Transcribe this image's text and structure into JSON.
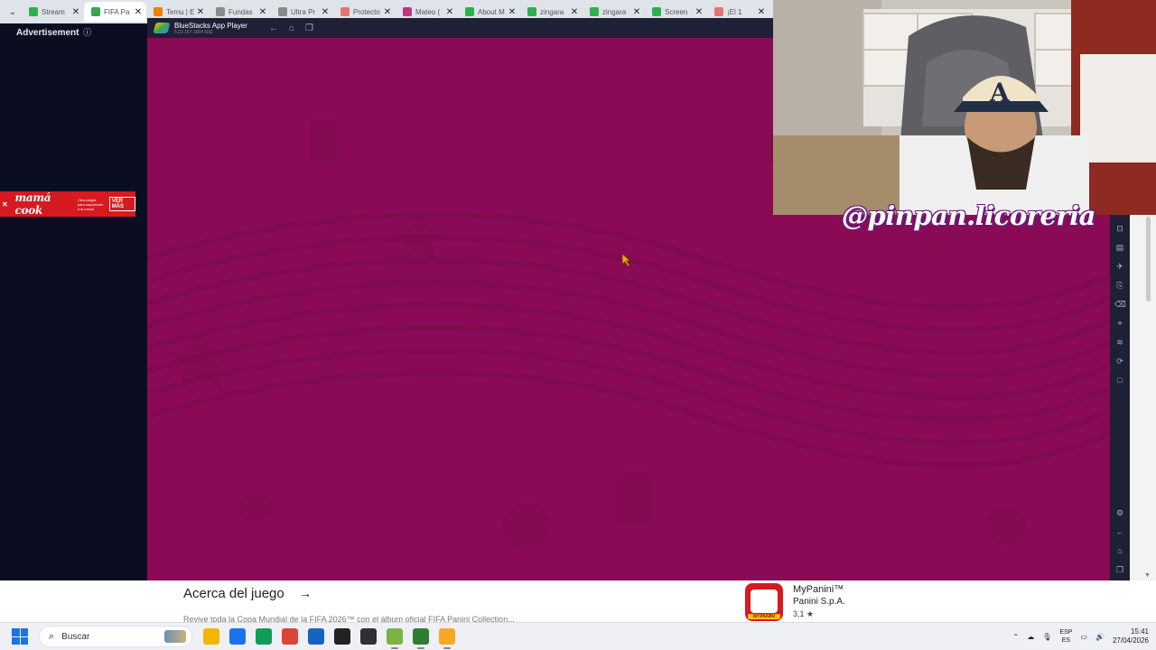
{
  "browser": {
    "tabs": [
      {
        "title": "Stream",
        "favicon_color": "#2bb24c",
        "active": false
      },
      {
        "title": "FIFA Pa",
        "favicon_color": "#34a853",
        "active": true
      },
      {
        "title": "Temu | E",
        "favicon_color": "#f57c00",
        "active": false
      },
      {
        "title": "Fundas",
        "favicon_color": "#8a8a8a",
        "active": false
      },
      {
        "title": "Ultra Pr",
        "favicon_color": "#8a8a8a",
        "active": false
      },
      {
        "title": "Protecto",
        "favicon_color": "#e57373",
        "active": false
      },
      {
        "title": "Mateo (",
        "favicon_color": "#c13584",
        "active": false
      },
      {
        "title": "About M",
        "favicon_color": "#2bb24c",
        "active": false
      },
      {
        "title": "zingara",
        "favicon_color": "#2bb24c",
        "active": false
      },
      {
        "title": "zingara",
        "favicon_color": "#2bb24c",
        "active": false
      },
      {
        "title": "Screen",
        "favicon_color": "#2bb24c",
        "active": false
      },
      {
        "title": "¡El 1",
        "favicon_color": "#e57373",
        "active": false
      }
    ]
  },
  "ad": {
    "label": "Advertisement",
    "info_icon": "info-icon",
    "banner": {
      "brand": "mamá cook",
      "tagline": "¡Tecnología para sorprender a la mesa!",
      "cta": "VER MÁS"
    }
  },
  "bluestacks": {
    "title": "BlueStacks App Player",
    "version": "5.22.167.1004 N32",
    "nav_icons": [
      "back-icon",
      "home-icon",
      "recents-icon"
    ],
    "toolbar_icons": [
      "screenshot-icon",
      "media-icon",
      "airplane-icon",
      "apk-icon",
      "eraser-icon",
      "location-icon",
      "layers-icon",
      "sync-icon",
      "blank-icon"
    ],
    "bottom_icons": [
      "settings-icon",
      "back-icon",
      "home-icon",
      "recents-icon"
    ]
  },
  "stream": {
    "watermark": "@pinpan.licoreria"
  },
  "store": {
    "section_title": "Acerca del juego",
    "description": "Revive toda la Copa Mundial de la FIFA 2026™ con el álbum oficial FIFA Panini Collection...",
    "app": {
      "name": "MyPanini™",
      "developer": "Panini S.p.A.",
      "rating": "3,1 ★",
      "icon_label": "MYPANINI"
    }
  },
  "taskbar": {
    "search_placeholder": "Buscar",
    "apps": [
      {
        "name": "file-explorer-icon",
        "color": "#f4b400"
      },
      {
        "name": "store-icon",
        "color": "#1a73e8"
      },
      {
        "name": "edge-icon",
        "color": "#0f9d58"
      },
      {
        "name": "chrome-icon",
        "color": "#db4437"
      },
      {
        "name": "notepad-icon",
        "color": "#1565c0"
      },
      {
        "name": "obs-icon",
        "color": "#222222"
      },
      {
        "name": "media-player-icon",
        "color": "#303030"
      },
      {
        "name": "bluestacks-icon",
        "color": "#7cb342"
      },
      {
        "name": "capcut-icon",
        "color": "#2e7d32"
      },
      {
        "name": "bluestacks-multi-icon",
        "color": "#f9a825"
      }
    ],
    "tray": {
      "lang_top": "ESP",
      "lang_bottom": "ES",
      "time": "15:41",
      "date": "27/04/2026"
    }
  },
  "colors": {
    "game_bg": "#8a0a55",
    "pattern": "#7a0a4c",
    "ad_bg": "#0b0e20"
  }
}
